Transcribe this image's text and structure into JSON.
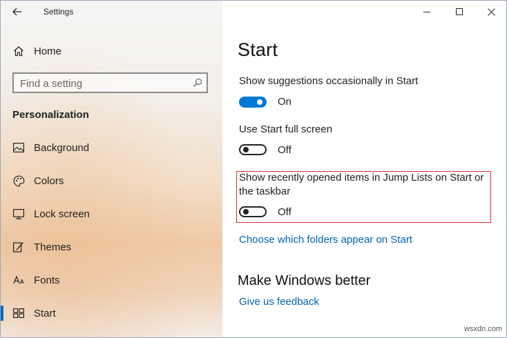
{
  "window": {
    "app_title": "Settings"
  },
  "sidebar": {
    "home_label": "Home",
    "search": {
      "placeholder": "Find a setting"
    },
    "section_title": "Personalization",
    "items": [
      {
        "label": "Background",
        "icon": "picture-icon"
      },
      {
        "label": "Colors",
        "icon": "palette-icon"
      },
      {
        "label": "Lock screen",
        "icon": "lock-screen-icon"
      },
      {
        "label": "Themes",
        "icon": "brush-icon"
      },
      {
        "label": "Fonts",
        "icon": "font-icon"
      },
      {
        "label": "Start",
        "icon": "start-layout-icon"
      }
    ],
    "active_item": "Start"
  },
  "main": {
    "title": "Start",
    "settings": [
      {
        "label": "Show suggestions occasionally in Start",
        "state": "On",
        "enabled": true
      },
      {
        "label": "Use Start full screen",
        "state": "Off",
        "enabled": false
      },
      {
        "label_line1": "Show recently opened items in Jump Lists on Start or",
        "label_line2": "the taskbar",
        "state": "Off",
        "enabled": false
      }
    ],
    "folders_link": "Choose which folders appear on Start",
    "section2_title": "Make Windows better",
    "feedback_link": "Give us feedback"
  },
  "watermark": "wsxdn.com",
  "colors": {
    "accent": "#0078d7",
    "link": "#0063b1",
    "highlight": "#d62a2a"
  }
}
